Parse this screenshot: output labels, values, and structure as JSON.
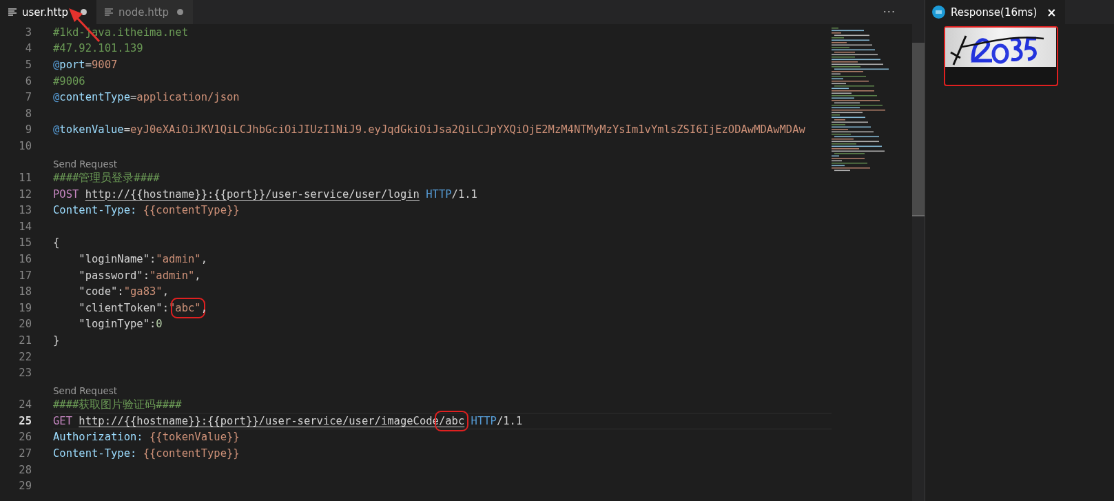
{
  "editor": {
    "tabs": [
      {
        "label": "user.http",
        "selected": true,
        "dirty": true
      },
      {
        "label": "node.http",
        "selected": false,
        "dirty": true
      }
    ],
    "more": "···",
    "lines": [
      {
        "number": "3",
        "current": false,
        "tokens": [
          {
            "kind": "comment",
            "text": "#1kd-java.itheima.net",
            "boxed": false
          }
        ]
      },
      {
        "number": "4",
        "current": false,
        "tokens": [
          {
            "kind": "comment",
            "text": "#47.92.101.139",
            "boxed": false
          }
        ]
      },
      {
        "number": "5",
        "current": false,
        "tokens": [
          {
            "kind": "at",
            "text": "@",
            "boxed": false
          },
          {
            "kind": "name",
            "text": "port",
            "boxed": false
          },
          {
            "kind": "plain",
            "text": "=",
            "boxed": false
          },
          {
            "kind": "value",
            "text": "9007",
            "boxed": false
          }
        ]
      },
      {
        "number": "6",
        "current": false,
        "tokens": [
          {
            "kind": "comment",
            "text": "#9006",
            "boxed": false
          }
        ]
      },
      {
        "number": "7",
        "current": false,
        "tokens": [
          {
            "kind": "at",
            "text": "@",
            "boxed": false
          },
          {
            "kind": "name",
            "text": "contentType",
            "boxed": false
          },
          {
            "kind": "plain",
            "text": "=",
            "boxed": false
          },
          {
            "kind": "value",
            "text": "application/json",
            "boxed": false
          }
        ]
      },
      {
        "number": "8",
        "current": false
      },
      {
        "number": "9",
        "current": false,
        "tokens": [
          {
            "kind": "at",
            "text": "@",
            "boxed": false
          },
          {
            "kind": "name",
            "text": "tokenValue",
            "boxed": false
          },
          {
            "kind": "plain",
            "text": "=",
            "boxed": false
          },
          {
            "kind": "value",
            "text": "eyJ0eXAiOiJKV1QiLCJhbGciOiJIUzI1NiJ9.eyJqdGkiOiJsa2QiLCJpYXQiOjE2MzM4NTMyMzYsIm1vYmlsZSI6IjEzODAwMDAwMDAw",
            "boxed": false
          }
        ]
      },
      {
        "number": "10",
        "current": false
      },
      {
        "number": "11",
        "current": false,
        "lens": "Send Request",
        "tokens": [
          {
            "kind": "comment",
            "text": "####管理员登录####",
            "boxed": false
          }
        ]
      },
      {
        "number": "12",
        "current": false,
        "tokens": [
          {
            "kind": "method",
            "text": "POST ",
            "boxed": false
          },
          {
            "kind": "url",
            "text": "http://{{hostname}}:{{port}}/user-service/user/login",
            "boxed": false
          },
          {
            "kind": "keyword",
            "text": " HTTP",
            "boxed": false
          },
          {
            "kind": "plain",
            "text": "/1.1",
            "boxed": false
          }
        ]
      },
      {
        "number": "13",
        "current": false,
        "tokens": [
          {
            "kind": "name",
            "text": "Content-Type: ",
            "boxed": false
          },
          {
            "kind": "value",
            "text": "{{contentType}}",
            "boxed": false
          }
        ]
      },
      {
        "number": "14",
        "current": false
      },
      {
        "number": "15",
        "current": false,
        "tokens": [
          {
            "kind": "plain",
            "text": "{",
            "boxed": false
          }
        ]
      },
      {
        "number": "16",
        "current": false,
        "tokens": [
          {
            "kind": "plain",
            "text": "    \"loginName\":",
            "boxed": false
          },
          {
            "kind": "value",
            "text": "\"admin\"",
            "boxed": false
          },
          {
            "kind": "plain",
            "text": ",",
            "boxed": false
          }
        ]
      },
      {
        "number": "17",
        "current": false,
        "tokens": [
          {
            "kind": "plain",
            "text": "    \"password\":",
            "boxed": false
          },
          {
            "kind": "value",
            "text": "\"admin\"",
            "boxed": false
          },
          {
            "kind": "plain",
            "text": ",",
            "boxed": false
          }
        ]
      },
      {
        "number": "18",
        "current": false,
        "tokens": [
          {
            "kind": "plain",
            "text": "    \"code\":",
            "boxed": false
          },
          {
            "kind": "value",
            "text": "\"ga83\"",
            "boxed": false
          },
          {
            "kind": "plain",
            "text": ",",
            "boxed": false
          }
        ]
      },
      {
        "number": "19",
        "current": false,
        "tokens": [
          {
            "kind": "plain",
            "text": "    \"clientToken\":",
            "boxed": false
          },
          {
            "kind": "value",
            "text": "\"",
            "boxed": false
          },
          {
            "kind": "value",
            "text": "abc\"",
            "boxed": true
          },
          {
            "kind": "plain",
            "text": ",",
            "boxed": false
          }
        ]
      },
      {
        "number": "20",
        "current": false,
        "tokens": [
          {
            "kind": "plain",
            "text": "    \"loginType\":",
            "boxed": false
          },
          {
            "kind": "number",
            "text": "0",
            "boxed": false
          }
        ]
      },
      {
        "number": "21",
        "current": false,
        "tokens": [
          {
            "kind": "plain",
            "text": "}",
            "boxed": false
          }
        ]
      },
      {
        "number": "22",
        "current": false
      },
      {
        "number": "23",
        "current": false
      },
      {
        "number": "24",
        "current": false,
        "lens": "Send Request",
        "tokens": [
          {
            "kind": "comment",
            "text": "####获取图片验证码####",
            "boxed": false
          }
        ]
      },
      {
        "number": "25",
        "current": true,
        "tokens": [
          {
            "kind": "method",
            "text": "GET ",
            "boxed": false
          },
          {
            "kind": "url",
            "text": "http://{{hostname}}:{{port}}/user-service/user/imageCode",
            "boxed": false
          },
          {
            "kind": "url",
            "text": "/abc",
            "boxed": true
          },
          {
            "kind": "keyword",
            "text": " HTTP",
            "boxed": false
          },
          {
            "kind": "plain",
            "text": "/1.1",
            "boxed": false
          }
        ]
      },
      {
        "number": "26",
        "current": false,
        "tokens": [
          {
            "kind": "name",
            "text": "Authorization: ",
            "boxed": false
          },
          {
            "kind": "value",
            "text": "{{tokenValue}}",
            "boxed": false
          }
        ]
      },
      {
        "number": "27",
        "current": false,
        "tokens": [
          {
            "kind": "name",
            "text": "Content-Type: ",
            "boxed": false
          },
          {
            "kind": "value",
            "text": "{{contentType}}",
            "boxed": false
          }
        ]
      },
      {
        "number": "28",
        "current": false
      },
      {
        "number": "29",
        "current": false
      }
    ]
  },
  "response": {
    "tab": {
      "label": "Response(16ms)",
      "close": "×"
    }
  }
}
